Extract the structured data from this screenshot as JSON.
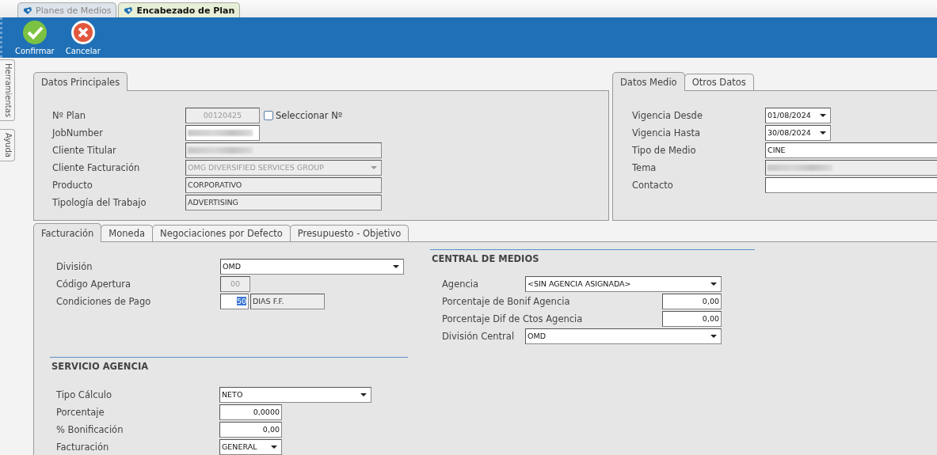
{
  "window_tabs": [
    {
      "label": "Planes de Medios",
      "selected": false
    },
    {
      "label": "Encabezado de Plan",
      "selected": true
    }
  ],
  "toolbar": {
    "buttons": [
      {
        "label": "Confirmar",
        "kind": "confirm"
      },
      {
        "label": "Cancelar",
        "kind": "cancel"
      }
    ]
  },
  "side_tabs": [
    {
      "label": "Herramientas"
    },
    {
      "label": "Ayuda"
    }
  ],
  "main_panel": {
    "tabs": [
      {
        "label": "Datos Principales",
        "selected": true
      }
    ],
    "fields": [
      {
        "label": "Nº Plan",
        "kind": "code",
        "value": "00120425",
        "disabled": true,
        "checkbox": {
          "label": "Seleccionar Nº",
          "checked": false
        }
      },
      {
        "label": "JobNumber",
        "kind": "code",
        "redacted": true,
        "disabled": false
      },
      {
        "label": "Cliente Titular",
        "kind": "text",
        "redacted": true,
        "disabled": true
      },
      {
        "label": "Cliente Facturación",
        "kind": "select",
        "value": "OMG DIVERSIFIED SERVICES GROUP",
        "disabled": true
      },
      {
        "label": "Producto",
        "kind": "text",
        "value": "CORPORATIVO",
        "disabled": true
      },
      {
        "label": "Tipología del Trabajo",
        "kind": "text",
        "value": "ADVERTISING",
        "disabled": true
      }
    ]
  },
  "media_panel": {
    "tabs": [
      {
        "label": "Datos Medio",
        "selected": true
      },
      {
        "label": "Otros Datos",
        "selected": false
      }
    ],
    "fields": [
      {
        "label": "Vigencia Desde",
        "kind": "date",
        "value": "01/08/2024",
        "disabled": false
      },
      {
        "label": "Vigencia Hasta",
        "kind": "date",
        "value": "30/08/2024",
        "disabled": false
      },
      {
        "label": "Tipo de Medio",
        "kind": "text",
        "value": "CINE",
        "disabled": false
      },
      {
        "label": "Tema",
        "kind": "text",
        "redacted": true,
        "disabled": true
      },
      {
        "label": "Contacto",
        "kind": "text",
        "disabled": false
      }
    ]
  },
  "billing_panel": {
    "tabs": [
      {
        "label": "Facturación",
        "selected": true
      },
      {
        "label": "Moneda",
        "selected": false
      },
      {
        "label": "Negociaciones por Defecto",
        "selected": false
      },
      {
        "label": "Presupuesto - Objetivo",
        "selected": false
      }
    ],
    "fields": [
      {
        "label": "División",
        "kind": "select",
        "value": "OMD",
        "disabled": false
      },
      {
        "label": "Código Apertura",
        "kind": "code",
        "value": "00",
        "disabled": true
      },
      {
        "label": "Condiciones de Pago",
        "kind": "pair",
        "value": "50",
        "text_selected": true,
        "description": "DIAS F.F.",
        "disabled": false
      }
    ],
    "agency_service": {
      "heading": "SERVICIO AGENCIA",
      "fields": [
        {
          "label": "Tipo Cálculo",
          "kind": "select",
          "value": "NETO",
          "disabled": false
        },
        {
          "label": "Porcentaje",
          "kind": "number",
          "value": "0,0000",
          "disabled": false
        },
        {
          "label": "% Bonificación",
          "kind": "number",
          "value": "0,00",
          "disabled": false
        },
        {
          "label": "Facturación",
          "kind": "combo",
          "value": "GENERAL",
          "disabled": false
        }
      ]
    },
    "media_central": {
      "heading": "CENTRAL DE MEDIOS",
      "fields": [
        {
          "label": "Agencia",
          "kind": "select",
          "value": "<SIN AGENCIA ASIGNADA>",
          "disabled": false
        },
        {
          "label": "Porcentaje de Bonif Agencia",
          "kind": "number",
          "value": "0,00",
          "disabled": false
        },
        {
          "label": "Porcentaje Dif de Ctos Agencia",
          "kind": "number",
          "value": "0,00",
          "disabled": false
        },
        {
          "label": "División Central",
          "kind": "select",
          "value": "OMD",
          "disabled": false
        }
      ]
    }
  }
}
